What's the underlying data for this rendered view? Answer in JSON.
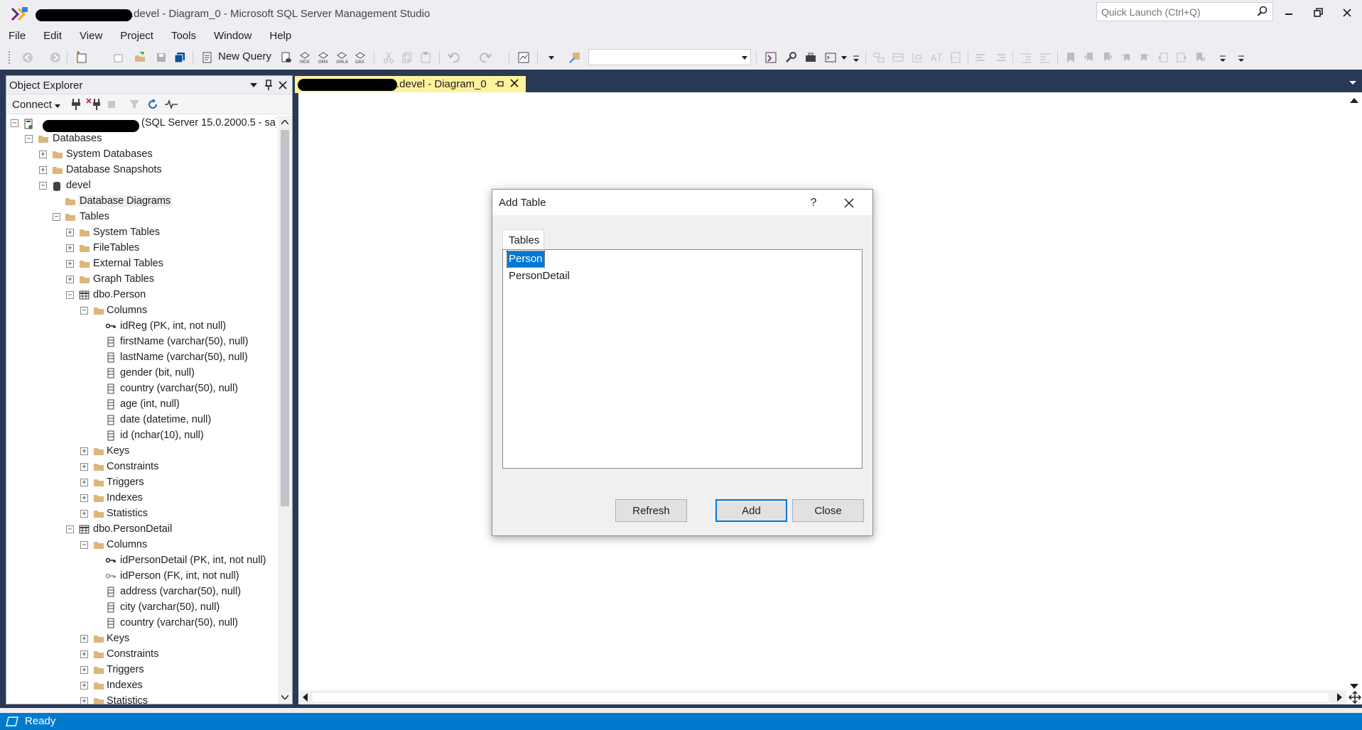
{
  "window": {
    "title_suffix": ".devel - Diagram_0 - Microsoft SQL Server Management Studio",
    "quick_launch_placeholder": "Quick Launch (Ctrl+Q)"
  },
  "menu": [
    "File",
    "Edit",
    "View",
    "Project",
    "Tools",
    "Window",
    "Help"
  ],
  "toolbar": {
    "new_query_label": "New Query",
    "database_combo_value": ""
  },
  "object_explorer": {
    "title": "Object Explorer",
    "connect_label": "Connect",
    "nodes": [
      {
        "label": "(SQL Server 15.0.2000.5 - sa)",
        "icon": "server-icon",
        "expander": "minus"
      },
      {
        "label": "Databases",
        "icon": "folder-icon",
        "expander": "minus"
      },
      {
        "label": "System Databases",
        "icon": "folder-icon",
        "expander": "plus"
      },
      {
        "label": "Database Snapshots",
        "icon": "folder-icon",
        "expander": "plus"
      },
      {
        "label": "devel",
        "icon": "database-icon",
        "expander": "minus"
      },
      {
        "label": "Database Diagrams",
        "icon": "folder-icon",
        "expander": "none",
        "selected": true
      },
      {
        "label": "Tables",
        "icon": "folder-icon",
        "expander": "minus"
      },
      {
        "label": "System Tables",
        "icon": "folder-icon",
        "expander": "plus"
      },
      {
        "label": "FileTables",
        "icon": "folder-icon",
        "expander": "plus"
      },
      {
        "label": "External Tables",
        "icon": "folder-icon",
        "expander": "plus"
      },
      {
        "label": "Graph Tables",
        "icon": "folder-icon",
        "expander": "plus"
      },
      {
        "label": "dbo.Person",
        "icon": "table-icon",
        "expander": "minus"
      },
      {
        "label": "Columns",
        "icon": "folder-icon",
        "expander": "minus"
      },
      {
        "label": "idReg (PK, int, not null)",
        "icon": "primary-key-icon",
        "expander": "none"
      },
      {
        "label": "firstName (varchar(50), null)",
        "icon": "column-icon",
        "expander": "none"
      },
      {
        "label": "lastName (varchar(50), null)",
        "icon": "column-icon",
        "expander": "none"
      },
      {
        "label": "gender (bit, null)",
        "icon": "column-icon",
        "expander": "none"
      },
      {
        "label": "country (varchar(50), null)",
        "icon": "column-icon",
        "expander": "none"
      },
      {
        "label": "age (int, null)",
        "icon": "column-icon",
        "expander": "none"
      },
      {
        "label": "date (datetime, null)",
        "icon": "column-icon",
        "expander": "none"
      },
      {
        "label": "id (nchar(10), null)",
        "icon": "column-icon",
        "expander": "none"
      },
      {
        "label": "Keys",
        "icon": "folder-icon",
        "expander": "plus"
      },
      {
        "label": "Constraints",
        "icon": "folder-icon",
        "expander": "plus"
      },
      {
        "label": "Triggers",
        "icon": "folder-icon",
        "expander": "plus"
      },
      {
        "label": "Indexes",
        "icon": "folder-icon",
        "expander": "plus"
      },
      {
        "label": "Statistics",
        "icon": "folder-icon",
        "expander": "plus"
      },
      {
        "label": "dbo.PersonDetail",
        "icon": "table-icon",
        "expander": "minus"
      },
      {
        "label": "Columns",
        "icon": "folder-icon",
        "expander": "minus"
      },
      {
        "label": "idPersonDetail (PK, int, not null)",
        "icon": "primary-key-icon",
        "expander": "none"
      },
      {
        "label": "idPerson (FK, int, not null)",
        "icon": "foreign-key-icon",
        "expander": "none"
      },
      {
        "label": "address (varchar(50), null)",
        "icon": "column-icon",
        "expander": "none"
      },
      {
        "label": "city (varchar(50), null)",
        "icon": "column-icon",
        "expander": "none"
      },
      {
        "label": "country (varchar(50), null)",
        "icon": "column-icon",
        "expander": "none"
      },
      {
        "label": "Keys",
        "icon": "folder-icon",
        "expander": "plus"
      },
      {
        "label": "Constraints",
        "icon": "folder-icon",
        "expander": "plus"
      },
      {
        "label": "Triggers",
        "icon": "folder-icon",
        "expander": "plus"
      },
      {
        "label": "Indexes",
        "icon": "folder-icon",
        "expander": "plus"
      },
      {
        "label": "Statistics",
        "icon": "folder-icon",
        "expander": "plus"
      }
    ]
  },
  "document_tab": {
    "label": ".devel - Diagram_0"
  },
  "dialog": {
    "title": "Add Table",
    "help_label": "?",
    "tab_label": "Tables",
    "items": [
      {
        "label": "Person",
        "selected": true
      },
      {
        "label": "PersonDetail",
        "selected": false
      }
    ],
    "buttons": {
      "refresh": "Refresh",
      "add": "Add",
      "close": "Close"
    }
  },
  "statusbar": {
    "text": "Ready"
  },
  "colors": {
    "workspace": "#293955",
    "statusbar": "#007acc",
    "tab_active": "#fff29d",
    "selection": "#0078d7",
    "folder": "#dcb67a"
  }
}
